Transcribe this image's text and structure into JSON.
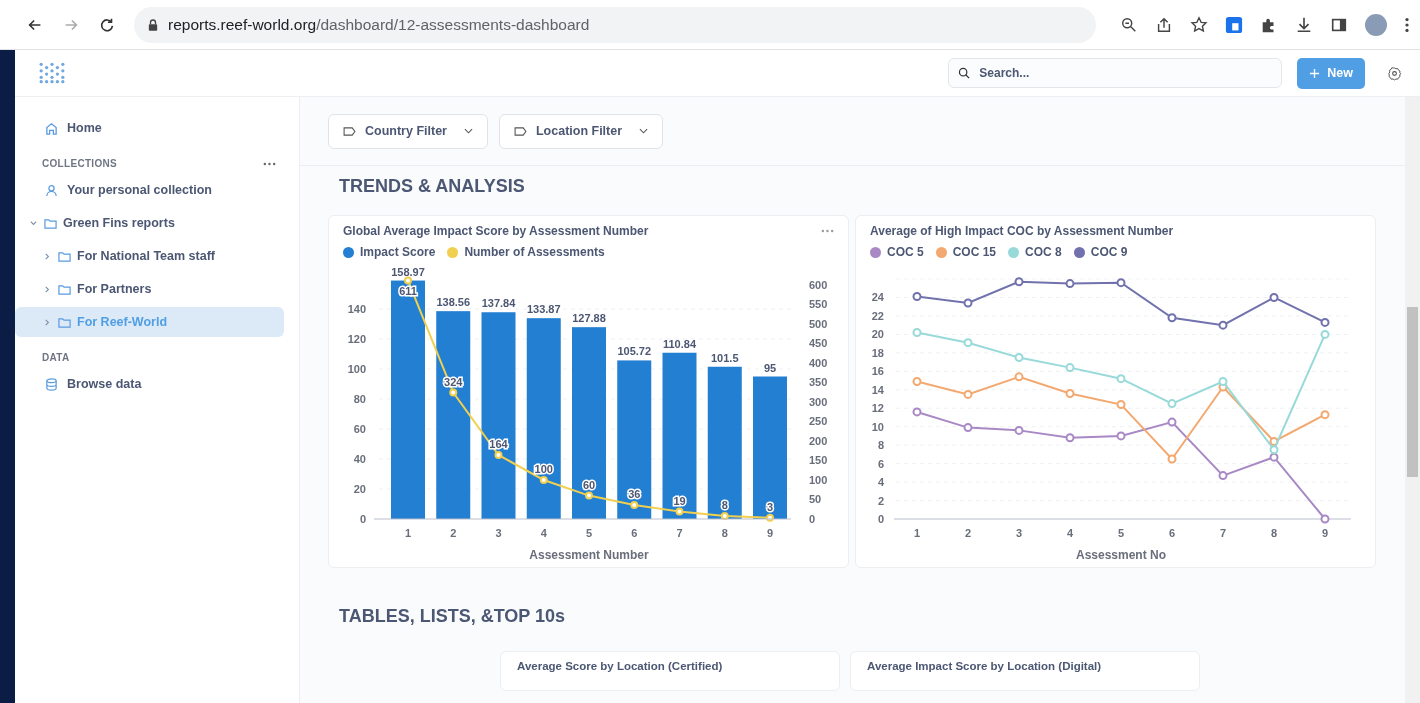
{
  "browser": {
    "url_host": "reports.reef-world.org",
    "url_path": "/dashboard/12-assessments-dashboard"
  },
  "header": {
    "search": {
      "placeholder": "Search..."
    },
    "new_button": "New"
  },
  "sidebar": {
    "items": [
      {
        "kind": "home",
        "label": "Home",
        "selected": false
      }
    ],
    "sections": [
      {
        "heading": "COLLECTIONS",
        "has_menu": true,
        "items": [
          {
            "kind": "person",
            "label": "Your personal collection",
            "selected": false
          },
          {
            "kind": "folder",
            "label": "Green Fins reports",
            "selected": false,
            "expanded": true,
            "children": [
              {
                "kind": "folder",
                "label": "For National Team staff",
                "selected": false,
                "expanded": false
              },
              {
                "kind": "folder",
                "label": "For Partners",
                "selected": false,
                "expanded": false
              },
              {
                "kind": "folder",
                "label": "For Reef-World",
                "selected": true,
                "expanded": false
              }
            ]
          }
        ]
      },
      {
        "heading": "DATA",
        "has_menu": false,
        "items": [
          {
            "kind": "database",
            "label": "Browse data",
            "selected": false
          }
        ]
      }
    ]
  },
  "filters": [
    {
      "label": "Country Filter"
    },
    {
      "label": "Location Filter"
    }
  ],
  "sections": [
    {
      "heading": "TRENDS & ANALYSIS"
    },
    {
      "heading": "TABLES, LISTS, &TOP 10s"
    }
  ],
  "charts": [
    {
      "has_menu": true,
      "chart_data": {
        "type": "bar",
        "title": "Global Average Impact Score by Assessment Number",
        "xlabel": "Assessment Number",
        "categories": [
          "1",
          "2",
          "3",
          "4",
          "5",
          "6",
          "7",
          "8",
          "9"
        ],
        "series": [
          {
            "name": "Impact Score",
            "color": "#227fd2",
            "values": [
              158.97,
              138.56,
              137.84,
              133.87,
              127.88,
              105.72,
              110.84,
              101.5,
              95
            ]
          },
          {
            "name": "Number of Assessments",
            "color": "#f1cf4f",
            "type": "line",
            "axis": "y2",
            "marker": "circle",
            "values": [
              611,
              324,
              164,
              100,
              60,
              36,
              19,
              8,
              3
            ]
          }
        ],
        "grid": true,
        "ylim": [
          0,
          160
        ],
        "yticks": [
          0,
          20,
          40,
          60,
          80,
          100,
          120,
          140
        ],
        "y2lim": [
          0,
          615
        ],
        "y2ticks": [
          0,
          50,
          100,
          150,
          200,
          250,
          300,
          350,
          400,
          450,
          500,
          550,
          600
        ],
        "data_labels": true
      }
    },
    {
      "has_menu": false,
      "chart_data": {
        "type": "line",
        "title": "Average of High Impact COC by Assessment Number",
        "xlabel": "Assessment No",
        "categories": [
          "1",
          "2",
          "3",
          "4",
          "5",
          "6",
          "7",
          "8",
          "9"
        ],
        "series": [
          {
            "name": "COC 5",
            "color": "#a989c5",
            "marker": "circle",
            "values": [
              11.6,
              9.9,
              9.6,
              8.8,
              9.0,
              10.5,
              4.7,
              6.7,
              0
            ]
          },
          {
            "name": "COC 15",
            "color": "#f2a86f",
            "marker": "circle",
            "values": [
              14.9,
              13.5,
              15.4,
              13.6,
              12.4,
              6.5,
              14.3,
              8.4,
              11.3
            ]
          },
          {
            "name": "COC 8",
            "color": "#98d9d9",
            "marker": "circle",
            "values": [
              20.2,
              19.1,
              17.5,
              16.4,
              15.2,
              12.5,
              14.9,
              7.5,
              20.0
            ]
          },
          {
            "name": "COC 9",
            "color": "#7172ad",
            "marker": "circle",
            "values": [
              24.1,
              23.4,
              25.7,
              25.5,
              25.6,
              21.8,
              21.0,
              24.0,
              21.3
            ]
          }
        ],
        "grid": true,
        "ylim": [
          0,
          26
        ],
        "yticks": [
          0,
          2,
          4,
          6,
          8,
          10,
          12,
          14,
          16,
          18,
          20,
          22,
          24
        ]
      }
    }
  ],
  "lower_cards": [
    {
      "title": "Average Score by Location (Certified)"
    },
    {
      "title": "Average Impact Score by Location (Digital)"
    }
  ]
}
